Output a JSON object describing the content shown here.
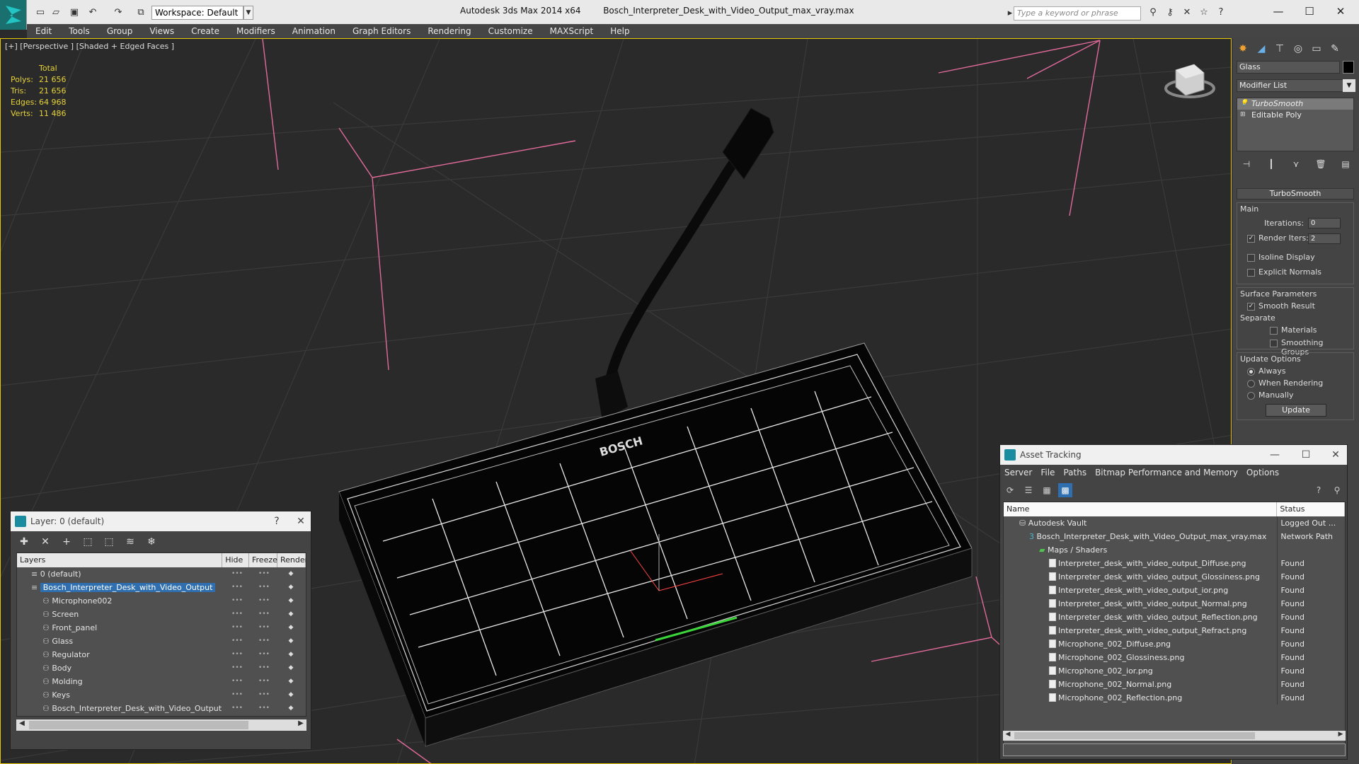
{
  "titlebar": {
    "workspace": "Workspace: Default",
    "app_title": "Autodesk 3ds Max  2014 x64",
    "file_name": "Bosch_Interpreter_Desk_with_Video_Output_max_vray.max",
    "search_placeholder": "Type a keyword or phrase"
  },
  "menu": [
    "Edit",
    "Tools",
    "Group",
    "Views",
    "Create",
    "Modifiers",
    "Animation",
    "Graph Editors",
    "Rendering",
    "Customize",
    "MAXScript",
    "Help"
  ],
  "viewport": {
    "label": "[+] [Perspective ] [Shaded + Edged Faces ]",
    "stats_header": "Total",
    "stats": [
      {
        "k": "Polys:",
        "v": "21 656"
      },
      {
        "k": "Tris:",
        "v": "21 656"
      },
      {
        "k": "Edges:",
        "v": "64 968"
      },
      {
        "k": "Verts:",
        "v": "11 486"
      }
    ],
    "brand_text": "BOSCH"
  },
  "command_panel": {
    "object_name": "Glass",
    "modifier_list": "Modifier List",
    "stack": [
      {
        "label": "TurboSmooth",
        "active": true
      },
      {
        "label": "Editable Poly",
        "active": false
      }
    ],
    "turbosmooth": {
      "title": "TurboSmooth",
      "main_label": "Main",
      "iterations_label": "Iterations:",
      "iterations_value": "0",
      "render_iters_label": "Render Iters:",
      "render_iters_value": "2",
      "isoline_label": "Isoline Display",
      "explicit_normals_label": "Explicit Normals",
      "surface_params_label": "Surface Parameters",
      "smooth_result_label": "Smooth Result",
      "separate_label": "Separate",
      "materials_label": "Materials",
      "smoothing_groups_label": "Smoothing Groups",
      "update_options_label": "Update Options",
      "always_label": "Always",
      "when_rendering_label": "When Rendering",
      "manually_label": "Manually",
      "update_button": "Update"
    }
  },
  "layer_window": {
    "title": "Layer: 0 (default)",
    "help": "?",
    "columns": [
      "Layers",
      "Hide",
      "Freeze",
      "Render"
    ],
    "rows": [
      {
        "name": "0 (default)",
        "indent": 1,
        "selected": false,
        "icon": "layer"
      },
      {
        "name": "Bosch_Interpreter_Desk_with_Video_Output",
        "indent": 1,
        "selected": true,
        "icon": "layer"
      },
      {
        "name": "Microphone002",
        "indent": 2,
        "selected": false,
        "icon": "object"
      },
      {
        "name": "Screen",
        "indent": 2,
        "selected": false,
        "icon": "object"
      },
      {
        "name": "Front_panel",
        "indent": 2,
        "selected": false,
        "icon": "object"
      },
      {
        "name": "Glass",
        "indent": 2,
        "selected": false,
        "icon": "object"
      },
      {
        "name": "Regulator",
        "indent": 2,
        "selected": false,
        "icon": "object"
      },
      {
        "name": "Body",
        "indent": 2,
        "selected": false,
        "icon": "object"
      },
      {
        "name": "Molding",
        "indent": 2,
        "selected": false,
        "icon": "object"
      },
      {
        "name": "Keys",
        "indent": 2,
        "selected": false,
        "icon": "object"
      },
      {
        "name": "Bosch_Interpreter_Desk_with_Video_Output",
        "indent": 2,
        "selected": false,
        "icon": "object"
      }
    ]
  },
  "asset_window": {
    "title": "Asset Tracking",
    "menu": [
      "Server",
      "File",
      "Paths",
      "Bitmap Performance and Memory",
      "Options"
    ],
    "columns": [
      "Name",
      "Status"
    ],
    "rows": [
      {
        "name": "Autodesk Vault",
        "status": "Logged Out ...",
        "indent": 1,
        "icon": "vault"
      },
      {
        "name": "Bosch_Interpreter_Desk_with_Video_Output_max_vray.max",
        "status": "Network Path",
        "indent": 2,
        "icon": "max"
      },
      {
        "name": "Maps / Shaders",
        "status": "",
        "indent": 3,
        "icon": "maps"
      },
      {
        "name": "Interpreter_desk_with_video_output_Diffuse.png",
        "status": "Found",
        "indent": 4,
        "icon": "file"
      },
      {
        "name": "Interpreter_desk_with_video_output_Glossiness.png",
        "status": "Found",
        "indent": 4,
        "icon": "file"
      },
      {
        "name": "Interpreter_desk_with_video_output_ior.png",
        "status": "Found",
        "indent": 4,
        "icon": "file"
      },
      {
        "name": "Interpreter_desk_with_video_output_Normal.png",
        "status": "Found",
        "indent": 4,
        "icon": "file"
      },
      {
        "name": "Interpreter_desk_with_video_output_Reflection.png",
        "status": "Found",
        "indent": 4,
        "icon": "file"
      },
      {
        "name": "Interpreter_desk_with_video_output_Refract.png",
        "status": "Found",
        "indent": 4,
        "icon": "file"
      },
      {
        "name": "Microphone_002_Diffuse.png",
        "status": "Found",
        "indent": 4,
        "icon": "file"
      },
      {
        "name": "Microphone_002_Glossiness.png",
        "status": "Found",
        "indent": 4,
        "icon": "file"
      },
      {
        "name": "Microphone_002_ior.png",
        "status": "Found",
        "indent": 4,
        "icon": "file"
      },
      {
        "name": "Microphone_002_Normal.png",
        "status": "Found",
        "indent": 4,
        "icon": "file"
      },
      {
        "name": "Microphone_002_Reflection.png",
        "status": "Found",
        "indent": 4,
        "icon": "file"
      }
    ]
  },
  "colors": {
    "accent": "#1a8ca0",
    "viewport_border": "#e8c800",
    "stats": "#e6d23a",
    "selection": "#2f6fb0",
    "bbox_lines": "#e06a9a"
  }
}
